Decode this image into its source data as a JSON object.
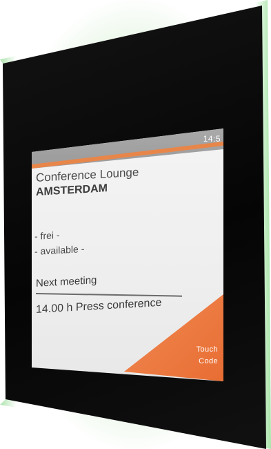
{
  "device": {
    "clock": "14:5",
    "room": {
      "name": "Conference Lounge",
      "location": "AMSTERDAM"
    },
    "status": {
      "german": "- frei -",
      "english": "- available -"
    },
    "next_meeting": {
      "label": "Next meeting",
      "event": "14.00 h Press conference"
    },
    "touch_button": {
      "line1": "Touch",
      "line2": "Code"
    }
  },
  "colors": {
    "accent": "#e8864a",
    "bar": "#a0a0a0",
    "glow": "#7cc56f"
  }
}
